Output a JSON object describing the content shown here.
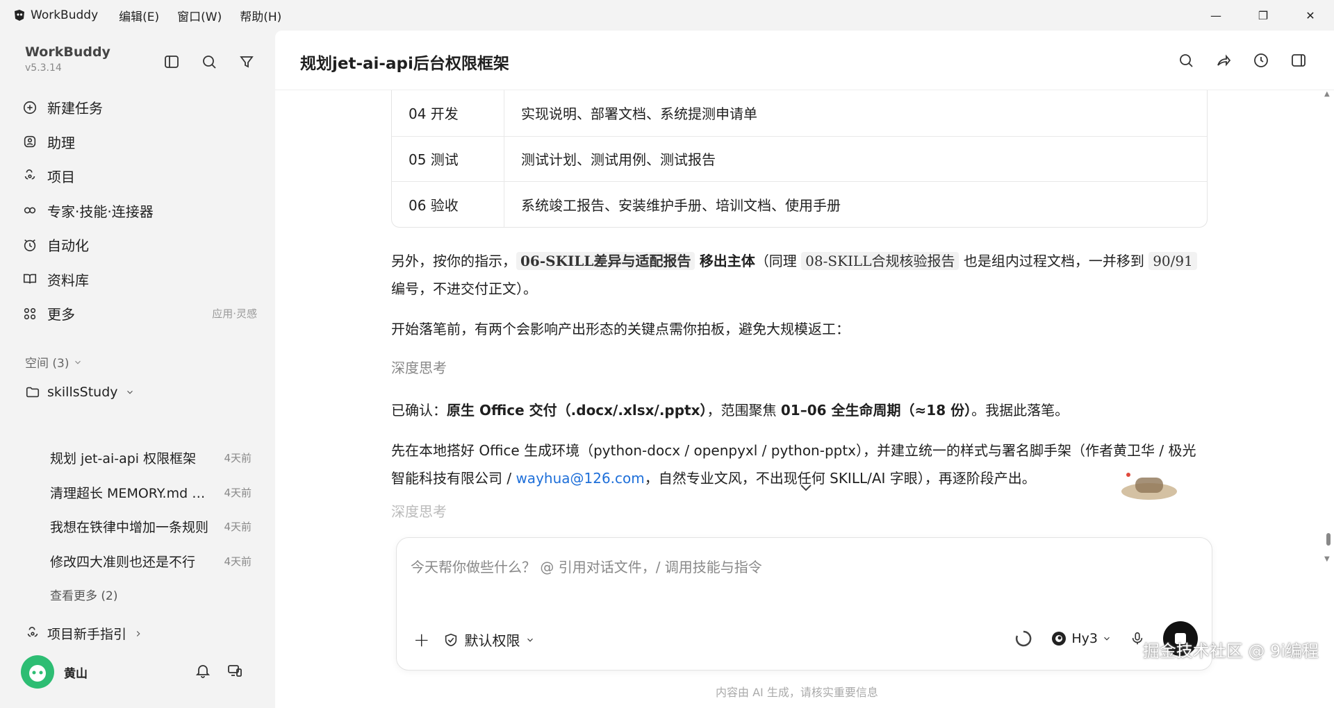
{
  "titlebar": {
    "app_name": "WorkBuddy",
    "menus": [
      "编辑(E)",
      "窗口(W)",
      "帮助(H)"
    ],
    "minimize": "—",
    "restore": "❐",
    "close": "✕"
  },
  "sidebar": {
    "brand": "WorkBuddy",
    "version": "v5.3.14",
    "nav": [
      {
        "label": "新建任务",
        "icon": "new-task-icon"
      },
      {
        "label": "助理",
        "icon": "assistant-icon"
      },
      {
        "label": "项目",
        "icon": "project-icon"
      },
      {
        "label": "专家·技能·连接器",
        "icon": "expert-icon"
      },
      {
        "label": "自动化",
        "icon": "automation-icon"
      },
      {
        "label": "资料库",
        "icon": "library-icon"
      },
      {
        "label": "更多",
        "icon": "more-icon",
        "hint": "应用·灵感"
      }
    ],
    "space_label": "空间 (3)",
    "folder": "skillsStudy",
    "tasks": [
      {
        "title": "规划 jet-ai-api 权限框架",
        "date": "4天前"
      },
      {
        "title": "清理超长 MEMORY.md 文件",
        "date": "4天前"
      },
      {
        "title": "我想在铁律中增加一条规则",
        "date": "4天前"
      },
      {
        "title": "修改四大准则也还是不行",
        "date": "4天前"
      }
    ],
    "more": "查看更多 (2)",
    "guide": "项目新手指引",
    "user": "黄山"
  },
  "main": {
    "title": "规划jet-ai-api后台权限框架",
    "table": [
      {
        "phase": "04 开发",
        "docs": "实现说明、部署文档、系统提测申请单"
      },
      {
        "phase": "05 测试",
        "docs": "测试计划、测试用例、测试报告"
      },
      {
        "phase": "06 验收",
        "docs": "系统竣工报告、安装维护手册、培训文档、使用手册"
      }
    ],
    "p1": {
      "a": "另外，按你的指示，",
      "code1": "06-SKILL差异与适配报告",
      "b": " ",
      "bold": "移出主体",
      "c": "（同理 ",
      "code2": "08-SKILL合规核验报告",
      "d": " 也是组内过程文档，一并移到 ",
      "code3": "90/91",
      "e": " 编号，不进交付正文）。"
    },
    "p2": "开始落笔前，有两个会影响产出形态的关键点需你拍板，避免大规模返工：",
    "think1": "深度思考",
    "p3": {
      "a": "已确认：",
      "b1": "原生 Office 交付（.docx/.xlsx/.pptx）",
      "c": "，范围聚焦 ",
      "b2": "01–06 全生命周期（≈18 份）",
      "d": "。我据此落笔。"
    },
    "p4": {
      "a": "先在本地搭好 Office 生成环境（python-docx / openpyxl / python-pptx），并建立统一的样式与署名脚手架（作者黄卫华 / 极光智能科技有限公司 / ",
      "link": "wayhua@126.com",
      "b": "，自然专业文风，不出现任何 SKILL/AI 字眼），再逐阶段产出。"
    },
    "think2": "深度思考"
  },
  "composer": {
    "placeholder": "今天帮你做些什么？ @ 引用对话文件，/ 调用技能与指令",
    "add": "+",
    "permission": "默认权限",
    "model": "Hy3"
  },
  "footer_note": "内容由 AI 生成，请核实重要信息",
  "watermark": "掘金技术社区 @ 9i编程"
}
